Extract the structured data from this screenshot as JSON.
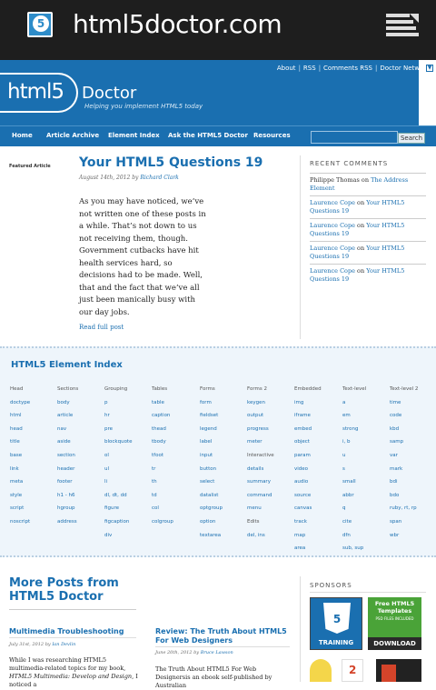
{
  "topbar": {
    "badge": "5",
    "domain": "html5doctor.com"
  },
  "header": {
    "links": [
      "About",
      "RSS",
      "Comments RSS",
      "Doctor Netw"
    ],
    "brand_html5": "html5",
    "brand_doctor": "Doctor",
    "tagline": "Helping you implement HTML5 today"
  },
  "nav": {
    "items": [
      "Home",
      "Article Archive",
      "Element Index",
      "Ask the HTML5 Doctor",
      "Resources"
    ],
    "search_button": "Search",
    "search_value": ""
  },
  "featured": {
    "label": "Featured Article",
    "title": "Your HTML5 Questions 19",
    "date": "August 14th, 2012",
    "by": "by",
    "author": "Richard Clark",
    "body": "As you may have noticed, we’ve not written one of these posts in a while. That’s not down to us not receiving them, though. Government cutbacks have hit health services hard, so decisions had to be made. Well, that and the fact that we’ve all just been manically busy with our day jobs.",
    "read_more": "Read full post"
  },
  "recent_comments": {
    "title": "RECENT COMMENTS",
    "on": "on",
    "items": [
      {
        "author": "Philippe Thomas",
        "author_linked": false,
        "post": "The Address Element"
      },
      {
        "author": "Laurence Cope",
        "author_linked": true,
        "post": "Your HTML5 Questions 19"
      },
      {
        "author": "Laurence Cope",
        "author_linked": true,
        "post": "Your HTML5 Questions 19"
      },
      {
        "author": "Laurence Cope",
        "author_linked": true,
        "post": "Your HTML5 Questions 19"
      },
      {
        "author": "Laurence Cope",
        "author_linked": true,
        "post": "Your HTML5 Questions 19"
      }
    ]
  },
  "element_index": {
    "title": "HTML5 Element Index",
    "columns": [
      {
        "head": "Head",
        "items": [
          "doctype",
          "html",
          "head",
          "title",
          "base",
          "link",
          "meta",
          "style",
          "script",
          "noscript"
        ]
      },
      {
        "head": "Sections",
        "items": [
          "body",
          "article",
          "nav",
          "aside",
          "section",
          "header",
          "footer",
          "h1 - h6",
          "hgroup",
          "address"
        ]
      },
      {
        "head": "Grouping",
        "items": [
          "p",
          "hr",
          "pre",
          "blockquote",
          "ol",
          "ul",
          "li",
          "dl, dt, dd",
          "figure",
          "figcaption",
          "div"
        ]
      },
      {
        "head": "Tables",
        "items": [
          "table",
          "caption",
          "thead",
          "tbody",
          "tfoot",
          "tr",
          "th",
          "td",
          "col",
          "colgroup"
        ]
      },
      {
        "head": "Forms",
        "items": [
          "form",
          "fieldset",
          "legend",
          "label",
          "input",
          "button",
          "select",
          "datalist",
          "optgroup",
          "option",
          "textarea"
        ]
      },
      {
        "head": "Forms 2",
        "items": [
          "keygen",
          "output",
          "progress",
          "meter"
        ],
        "head2": "Interactive",
        "items2": [
          "details",
          "summary",
          "command",
          "menu"
        ],
        "head3": "Edits",
        "items3": [
          "del, ins"
        ]
      },
      {
        "head": "Embedded",
        "items": [
          "img",
          "iframe",
          "embed",
          "object",
          "param",
          "video",
          "audio",
          "source",
          "canvas",
          "track",
          "map",
          "area"
        ]
      },
      {
        "head": "Text-level",
        "items": [
          "a",
          "em",
          "strong",
          "i, b",
          "u",
          "s",
          "small",
          "abbr",
          "q",
          "cite",
          "dfn",
          "sub, sup"
        ]
      },
      {
        "head": "Text-level 2",
        "items": [
          "time",
          "code",
          "kbd",
          "samp",
          "var",
          "mark",
          "bdi",
          "bdo",
          "ruby, rt, rp",
          "span",
          "wbr"
        ]
      }
    ]
  },
  "more_posts": {
    "title": "More Posts from HTML5 Doctor",
    "posts": [
      {
        "title": "Multimedia Troubleshooting",
        "date": "July 31st, 2012",
        "by": "by",
        "author": "Ian Devlin",
        "body_a": "While I was researching HTML5 multimedia-related topics for my book, ",
        "body_em": "HTML5 Multimedia: Develop and Design",
        "body_b": ", I noticed a"
      },
      {
        "title": "Review: The Truth About HTML5 For Web Designers",
        "date": "June 20th, 2012",
        "by": "by",
        "author": "Bruce Lawson",
        "body_a": "The Truth About HTML5 For Web Designersis an ebook self-published by Australian",
        "body_em": "",
        "body_b": ""
      }
    ]
  },
  "sponsors": {
    "title": "SPONSORS",
    "training": {
      "top": "HTML",
      "badge": "5",
      "label": "TRAINING"
    },
    "templates": {
      "headline": "Free HTML5 Templates",
      "sub": "PSD FILES INCLUDED",
      "cta": "DOWNLOAD"
    },
    "badge2": "2"
  },
  "colors": {
    "brand_blue": "#1a6fb0",
    "topbar": "#1e1e1e",
    "sponsor_green": "#4aa338"
  }
}
